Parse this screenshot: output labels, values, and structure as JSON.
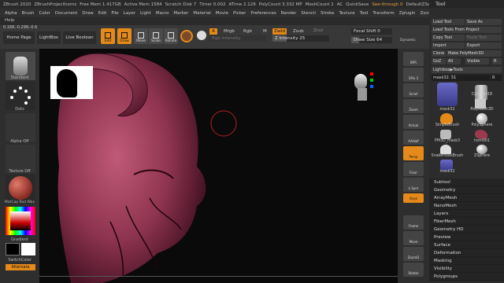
{
  "titlebar": {
    "items": [
      "ZBrush 2020",
      "ZBrushProjecthorns",
      "Free Mem 1.417GB",
      "Active Mem 1584",
      "Scratch Disk 7",
      "Timer 0.002",
      "ATime 2.129",
      "PolyCount 3.332 MP",
      "MeshCount 1"
    ],
    "ac": "AC",
    "quicksave": "QuickSave",
    "seethrough": "See-through  0",
    "default": "DefaultZScript"
  },
  "menu": [
    "Alpha",
    "Brush",
    "Color",
    "Document",
    "Draw",
    "Edit",
    "File",
    "Layer",
    "Light",
    "Macro",
    "Marker",
    "Material",
    "Movie",
    "Picker",
    "Preferences",
    "Render",
    "Stencil",
    "Stroke",
    "Texture",
    "Tool",
    "Transform",
    "Zplugin",
    "Zscript"
  ],
  "help": {
    "label": "Help",
    "coords": "0.168,-0.298,-0.6"
  },
  "toolbar": {
    "home": "Home Page",
    "lightbox": "LightBox",
    "liveboolean": "Live Boolean",
    "edit": "Edit",
    "draw": "Draw",
    "move": "Move",
    "scale": "Scale",
    "rotate": "Rotate",
    "a": "A",
    "mrgb": "Mrgb",
    "rgb": "Rgb",
    "m": "M",
    "zadd": "Zadd",
    "zsub": "Zsub",
    "zcut": "Zcut",
    "rgb_intensity": "Rgb Intensity",
    "z_intensity_label": "Z Intensity",
    "z_intensity_value": "25",
    "focal_shift_label": "Focal Shift",
    "focal_shift_value": "0",
    "draw_size_label": "Draw Size",
    "draw_size_value": "64",
    "dynamic": "Dynamic"
  },
  "left": {
    "standard": "Standard",
    "dots": "Dots",
    "alpha_off": "Alpha Off",
    "texture_off": "Texture Off",
    "matcap": "MatCap Red Wax",
    "gradient": "Gradient",
    "switchcolor": "SwitchColor",
    "alternate": "Alternate"
  },
  "shelf": [
    "BPR",
    "SPix 3",
    "Scroll",
    "Zoom",
    "Actual",
    "AAHalf",
    "Persp",
    "Floor",
    "L.Sym",
    "Qxyz",
    "Frame",
    "Move",
    "ZoomD",
    "Rotate"
  ],
  "tool": {
    "title": "Tool",
    "load_tool": "Load Tool",
    "save_as": "Save As",
    "load_project": "Load Tools From Project",
    "copy_tool": "Copy Tool",
    "paste_tool": "Paste Tool",
    "import": "Import",
    "export": "Export",
    "clone": "Clone",
    "make_polymesh": "Make PolyMesh3D",
    "goz": "GoZ",
    "all": "All",
    "visible": "Visible",
    "r": "R",
    "lightbox_tools": "Lightbox▶Tools",
    "current_tool": "mask32. 51",
    "thumbs": [
      "mask32",
      "Cylinder3D",
      "PolyMesh3D",
      "SimpleBrush",
      "PolySphere",
      "PM3D_mask3",
      "horn001",
      "SnakeHookBrush",
      "ZSphere",
      "mask32"
    ],
    "sections": [
      "Subtool",
      "Geometry",
      "ArrayMesh",
      "NanoMesh",
      "Layers",
      "FiberMesh",
      "Geometry HD",
      "Preview",
      "Surface",
      "Deformation",
      "Masking",
      "Visibility",
      "Polygroups"
    ]
  },
  "colors": {
    "accent": "#e58a1a",
    "model": "#9b3a55"
  }
}
